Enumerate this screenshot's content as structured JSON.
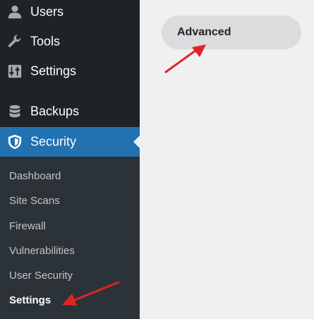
{
  "sidebar": {
    "items": [
      {
        "label": "Users",
        "icon": "user-icon"
      },
      {
        "label": "Tools",
        "icon": "wrench-icon"
      },
      {
        "label": "Settings",
        "icon": "settings-icon"
      },
      {
        "label": "Backups",
        "icon": "database-icon"
      },
      {
        "label": "Security",
        "icon": "shield-icon",
        "active": true
      }
    ],
    "submenu": [
      {
        "label": "Dashboard"
      },
      {
        "label": "Site Scans"
      },
      {
        "label": "Firewall"
      },
      {
        "label": "Vulnerabilities"
      },
      {
        "label": "User Security"
      },
      {
        "label": "Settings",
        "current": true
      }
    ]
  },
  "main": {
    "tab_label": "Advanced"
  },
  "colors": {
    "sidebar_bg": "#1d2327",
    "submenu_bg": "#2c3338",
    "active_bg": "#2271b1",
    "page_bg": "#f0f0f1",
    "pill_bg": "#dcdcde",
    "annotation_arrow": "#e02424"
  }
}
